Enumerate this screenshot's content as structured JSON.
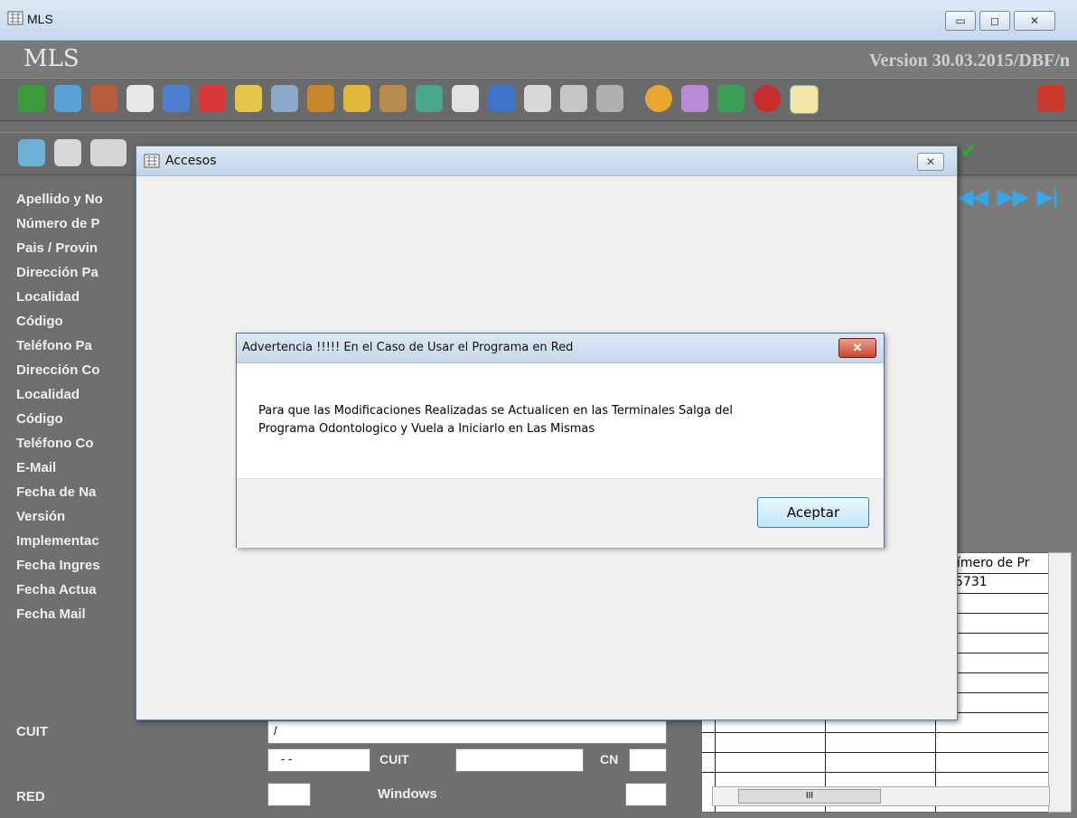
{
  "window": {
    "title": "MLS",
    "minimize": "▭",
    "maximize": "◻",
    "close": "✕"
  },
  "header": {
    "app_name": "MLS",
    "version": "Version 30.03.2015/DBF/n"
  },
  "toolbar1": {
    "icons": [
      "money-icon",
      "accounting-icon",
      "user-remove-icon",
      "notepad-icon",
      "lab-icon",
      "book-icon",
      "eraser-icon",
      "font-icon",
      "folder-icon",
      "search-icon",
      "tool-icon",
      "image-icon",
      "eye-icon",
      "calculator-icon",
      "calendar-icon",
      "implant-icon",
      "tube-icon",
      "coin-icon",
      "eraser2-icon",
      "exit-person-icon",
      "apple-icon",
      "key-icon",
      "door-exit-icon"
    ]
  },
  "toolbar2": {
    "icons": [
      "dental-chair-icon",
      "firstaid-icon",
      "tooth-icon"
    ],
    "check_icon": "✔"
  },
  "form": {
    "labels": [
      "Apellido y No",
      "Número de P",
      "Pais / Provin",
      "Dirección Pa",
      "Localidad",
      "Código",
      "Teléfono Pa",
      "Dirección Co",
      "Localidad",
      "Código",
      "Teléfono Co",
      "E-Mail",
      "Fecha de Na",
      "Versión",
      "Implementac",
      "Fecha Ingres",
      "Fecha Actua",
      "Fecha Mail",
      "CUIT",
      "",
      "RED"
    ],
    "cuit_value": "/",
    "date_value": "- -",
    "cuit_label2": "CUIT",
    "cn_label": "CN",
    "windows_label": "Windows"
  },
  "nav": {
    "prev": "◀◀",
    "next": "▶▶",
    "last": "▶|"
  },
  "grid": {
    "header": "ímero de Pr",
    "first_value": "5731",
    "hscroll_thumb": "III"
  },
  "accesos": {
    "title": "Accesos",
    "close": "✕"
  },
  "warning": {
    "title": "Advertencia !!!!! En el Caso de Usar el Programa en Red",
    "close": "✕",
    "line1": "Para que las Modificaciones Realizadas se Actualicen en las Terminales Salga del",
    "line2": "Programa Odontologico y Vuela a Iniciarlo en Las Mismas",
    "ok_label": "Aceptar"
  }
}
